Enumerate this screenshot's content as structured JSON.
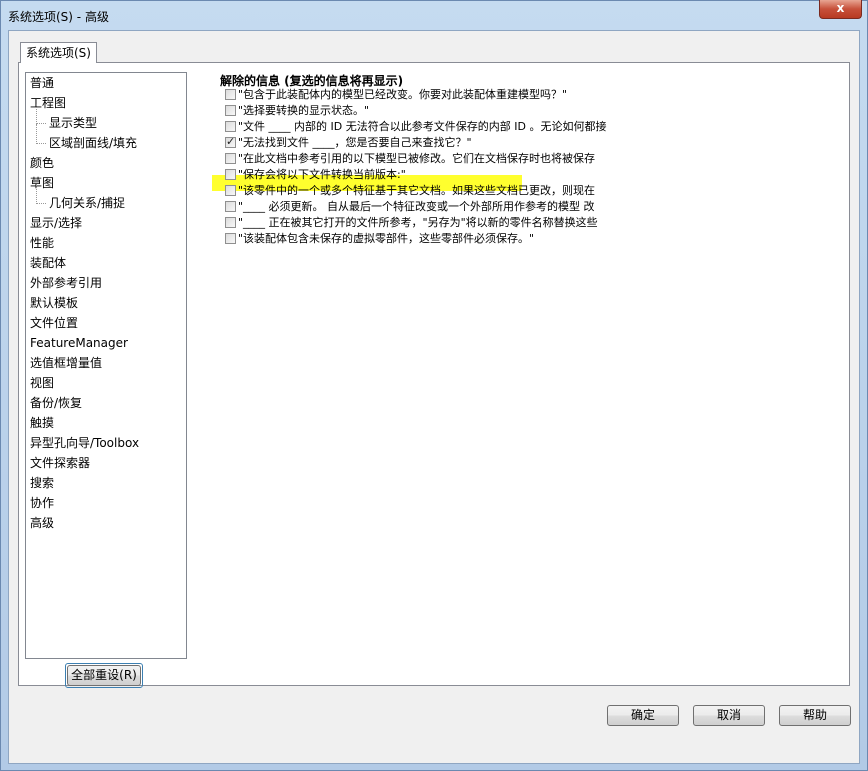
{
  "window": {
    "title": "系统选项(S) - 高级",
    "close_label": "x"
  },
  "tab": {
    "label": "系统选项(S)"
  },
  "tree": {
    "items": [
      {
        "label": "普通",
        "level": 0
      },
      {
        "label": "工程图",
        "level": 0
      },
      {
        "label": "显示类型",
        "level": 1
      },
      {
        "label": "区域剖面线/填充",
        "level": 1
      },
      {
        "label": "颜色",
        "level": 0
      },
      {
        "label": "草图",
        "level": 0
      },
      {
        "label": "几何关系/捕捉",
        "level": 1
      },
      {
        "label": "显示/选择",
        "level": 0
      },
      {
        "label": "性能",
        "level": 0
      },
      {
        "label": "装配体",
        "level": 0
      },
      {
        "label": "外部参考引用",
        "level": 0
      },
      {
        "label": "默认模板",
        "level": 0
      },
      {
        "label": "文件位置",
        "level": 0
      },
      {
        "label": "FeatureManager",
        "level": 0
      },
      {
        "label": "选值框增量值",
        "level": 0
      },
      {
        "label": "视图",
        "level": 0
      },
      {
        "label": "备份/恢复",
        "level": 0
      },
      {
        "label": "触摸",
        "level": 0
      },
      {
        "label": "异型孔向导/Toolbox",
        "level": 0
      },
      {
        "label": "文件探索器",
        "level": 0
      },
      {
        "label": "搜索",
        "level": 0
      },
      {
        "label": "协作",
        "level": 0
      },
      {
        "label": "高级",
        "level": 0
      }
    ]
  },
  "reset_button": {
    "label": "全部重设(R)"
  },
  "messages": {
    "heading": "解除的信息 (复选的信息将再显示)",
    "items": [
      {
        "text": "\"包含于此装配体内的模型已经改变。你要对此装配体重建模型吗？\"",
        "checked": false
      },
      {
        "text": "\"选择要转换的显示状态。\"",
        "checked": false
      },
      {
        "text": "\"文件 ____ 内部的 ID 无法符合以此参考文件保存的内部 ID 。无论如何都接",
        "checked": false
      },
      {
        "text": "\"无法找到文件 ____，您是否要自己来查找它？\"",
        "checked": true
      },
      {
        "text": "\"在此文档中参考引用的以下模型已被修改。它们在文档保存时也将被保存",
        "checked": false
      },
      {
        "text": "\"保存会将以下文件转换当前版本:\"",
        "checked": false
      },
      {
        "text": "\"该零件中的一个或多个特征基于其它文档。如果这些文档已更改，则现在",
        "checked": false
      },
      {
        "text": "\"____ 必须更新。  自从最后一个特征改变或一个外部所用作参考的模型 改",
        "checked": false
      },
      {
        "text": "\"____ 正在被其它打开的文件所参考，\"另存为\"将以新的零件名称替换这些",
        "checked": false
      },
      {
        "text": "\"该装配体包含未保存的虚拟零部件，这些零部件必须保存。\"",
        "checked": false
      }
    ]
  },
  "footer": {
    "ok_label": "确定",
    "cancel_label": "取消",
    "help_label": "帮助"
  },
  "colors": {
    "highlight": "#ffff2e"
  }
}
